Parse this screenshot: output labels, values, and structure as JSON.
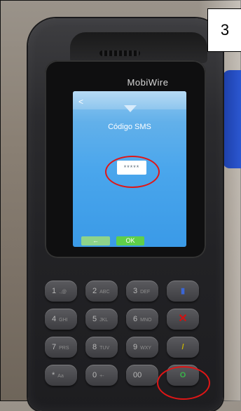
{
  "step_label": "3",
  "device": {
    "brand": "MobiWire",
    "screen": {
      "back_icon": "back-arrow-icon",
      "title": "Código SMS",
      "pin_value": "*****",
      "buttons": {
        "back_label": "←",
        "ok_label": "OK"
      }
    }
  },
  "keypad": {
    "keys": [
      {
        "label": "1",
        "sub": ".,@"
      },
      {
        "label": "2",
        "sub": "ABC"
      },
      {
        "label": "3",
        "sub": "DEF"
      },
      {
        "label": "4",
        "sub": "GHI"
      },
      {
        "label": "5",
        "sub": "JKL"
      },
      {
        "label": "6",
        "sub": "MNO"
      },
      {
        "label": "7",
        "sub": "PRS"
      },
      {
        "label": "8",
        "sub": "TUV"
      },
      {
        "label": "9",
        "sub": "WXY"
      },
      {
        "label": "*",
        "sub": "Aa"
      },
      {
        "label": "0",
        "sub": "+-"
      },
      {
        "label": "00",
        "sub": ""
      }
    ],
    "function_keys": {
      "menu": "card-icon",
      "cancel": "✕",
      "clear": "/",
      "enter": "O"
    }
  },
  "colors": {
    "screen_bg": "#4aa6ec",
    "ok_button": "#5fcf49",
    "highlight_ring": "#e01616"
  }
}
